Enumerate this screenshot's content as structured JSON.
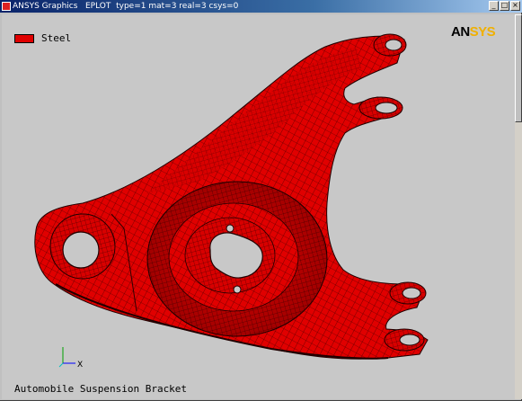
{
  "window": {
    "title": "ANSYS Graphics   EPLOT  type=1 mat=3 real=3 csys=0",
    "btn_min": "_",
    "btn_max": "□",
    "btn_close": "×"
  },
  "legend": {
    "label": "Steel",
    "color": "#e00000"
  },
  "logo": {
    "part1": "AN",
    "part2": "SYS"
  },
  "triad": {
    "x_label": "X"
  },
  "caption": "Automobile Suspension Bracket",
  "colors": {
    "model_fill": "#e00000",
    "mesh_lines": "#400000",
    "background": "#c8c8c8"
  }
}
